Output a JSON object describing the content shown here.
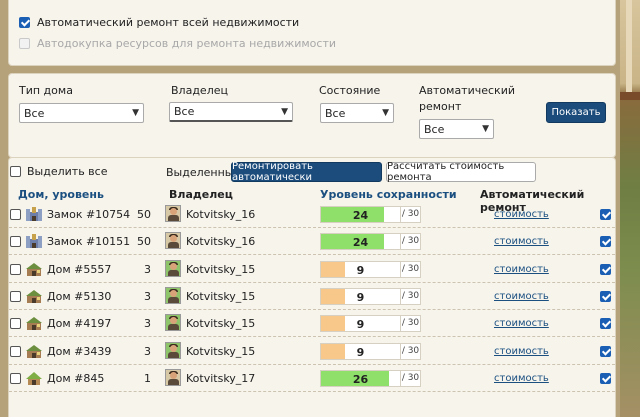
{
  "options": {
    "auto_repair_all": {
      "label": "Автоматический ремонт всей недвижимости",
      "checked": true
    },
    "auto_buy_resources": {
      "label": "Автодокупка ресурсов для ремонта недвижимости",
      "checked": false,
      "disabled": true
    }
  },
  "filters": {
    "house_type": {
      "label": "Тип дома",
      "value": "Все"
    },
    "owner": {
      "label": "Владелец",
      "value": "Все"
    },
    "state": {
      "label": "Состояние",
      "value": "Все"
    },
    "auto_repair": {
      "label_line1": "Автоматический",
      "label_line2": "ремонт",
      "value": "Все"
    },
    "show_button": "Показать"
  },
  "toolbar": {
    "select_all": "Выделить все",
    "selected_label": "Выделенные:",
    "repair_auto_button": "Ремонтировать автоматически",
    "calc_cost_button": "Рассчитать стоимость ремонта"
  },
  "table": {
    "headers": {
      "house_level": "Дом, уровень",
      "owner": "Владелец",
      "preservation": "Уровень сохранности",
      "auto_repair": "Автоматический ремонт"
    },
    "rows": [
      {
        "name": "Замок #10754",
        "level": "50",
        "icon": "castle-icon",
        "owner": "Kotvitsky_16",
        "avatar": "brown",
        "preservation": 24,
        "max": "/ 30",
        "bar_color": "green",
        "cost": "стоимость",
        "auto": true
      },
      {
        "name": "Замок #10151",
        "level": "50",
        "icon": "castle-icon",
        "owner": "Kotvitsky_16",
        "avatar": "brown",
        "preservation": 24,
        "max": "/ 30",
        "bar_color": "green",
        "cost": "стоимость",
        "auto": true
      },
      {
        "name": "Дом #5557",
        "level": "3",
        "icon": "house-icon",
        "owner": "Kotvitsky_15",
        "avatar": "green",
        "preservation": 9,
        "max": "/ 30",
        "bar_color": "orange",
        "cost": "стоимость",
        "auto": true
      },
      {
        "name": "Дом #5130",
        "level": "3",
        "icon": "house-icon",
        "owner": "Kotvitsky_15",
        "avatar": "green",
        "preservation": 9,
        "max": "/ 30",
        "bar_color": "orange",
        "cost": "стоимость",
        "auto": true
      },
      {
        "name": "Дом #4197",
        "level": "3",
        "icon": "house-icon",
        "owner": "Kotvitsky_15",
        "avatar": "green",
        "preservation": 9,
        "max": "/ 30",
        "bar_color": "orange",
        "cost": "стоимость",
        "auto": true
      },
      {
        "name": "Дом #3439",
        "level": "3",
        "icon": "house-icon",
        "owner": "Kotvitsky_15",
        "avatar": "green",
        "preservation": 9,
        "max": "/ 30",
        "bar_color": "orange",
        "cost": "стоимость",
        "auto": true
      },
      {
        "name": "Дом #845",
        "level": "1",
        "icon": "hut-icon",
        "owner": "Kotvitsky_17",
        "avatar": "brown",
        "preservation": 26,
        "max": "/ 30",
        "bar_color": "green",
        "cost": "стоимость",
        "auto": true
      }
    ]
  },
  "colors": {
    "primary_button": "#1c4c7c",
    "link": "#1a4f80",
    "bar_green": "#8ee06a",
    "bar_orange": "#f8c78a"
  }
}
